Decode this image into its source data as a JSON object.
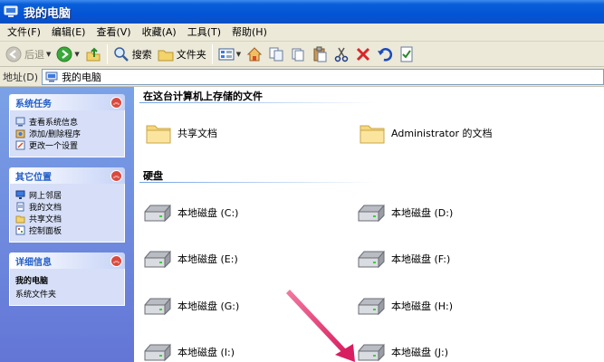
{
  "window": {
    "title": "我的电脑"
  },
  "menu": [
    "文件(F)",
    "编辑(E)",
    "查看(V)",
    "收藏(A)",
    "工具(T)",
    "帮助(H)"
  ],
  "toolbar": {
    "back": "后退",
    "search": "搜索",
    "folders": "文件夹"
  },
  "address": {
    "label": "地址(D)",
    "value": "我的电脑"
  },
  "sidebar": {
    "system_tasks": {
      "title": "系统任务",
      "items": [
        "查看系统信息",
        "添加/删除程序",
        "更改一个设置"
      ]
    },
    "other_places": {
      "title": "其它位置",
      "items": [
        "网上邻居",
        "我的文档",
        "共享文档",
        "控制面板"
      ]
    },
    "details": {
      "title": "详细信息",
      "name": "我的电脑",
      "sub": "系统文件夹"
    }
  },
  "content": {
    "files_group": "在这台计算机上存储的文件",
    "folders": [
      "共享文档",
      "Administrator 的文档"
    ],
    "drives_group": "硬盘",
    "drives": [
      "本地磁盘 (C:)",
      "本地磁盘 (D:)",
      "本地磁盘 (E:)",
      "本地磁盘 (F:)",
      "本地磁盘 (G:)",
      "本地磁盘 (H:)",
      "本地磁盘 (I:)",
      "本地磁盘 (J:)"
    ]
  },
  "colors": {
    "titlebar": "#0454d6",
    "taskpane": "#6375d6",
    "arrow": "#e0306f"
  }
}
